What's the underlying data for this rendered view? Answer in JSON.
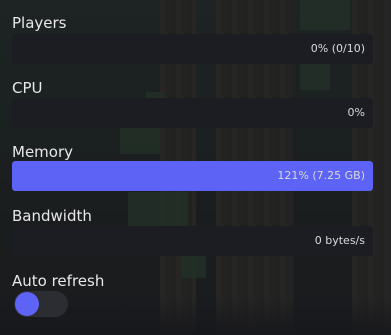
{
  "metrics": {
    "players": {
      "label": "Players",
      "value": "0% (0/10)",
      "percent": 0
    },
    "cpu": {
      "label": "CPU",
      "value": "0%",
      "percent": 0
    },
    "memory": {
      "label": "Memory",
      "value": "121% (7.25 GB)",
      "percent": 121
    },
    "bandwidth": {
      "label": "Bandwidth",
      "value": "0 bytes/s",
      "percent": 0
    }
  },
  "auto_refresh": {
    "label": "Auto refresh",
    "enabled": true
  },
  "colors": {
    "accent": "#5d63f5",
    "track": "#1c1d22",
    "text": "#e8e8ea"
  }
}
